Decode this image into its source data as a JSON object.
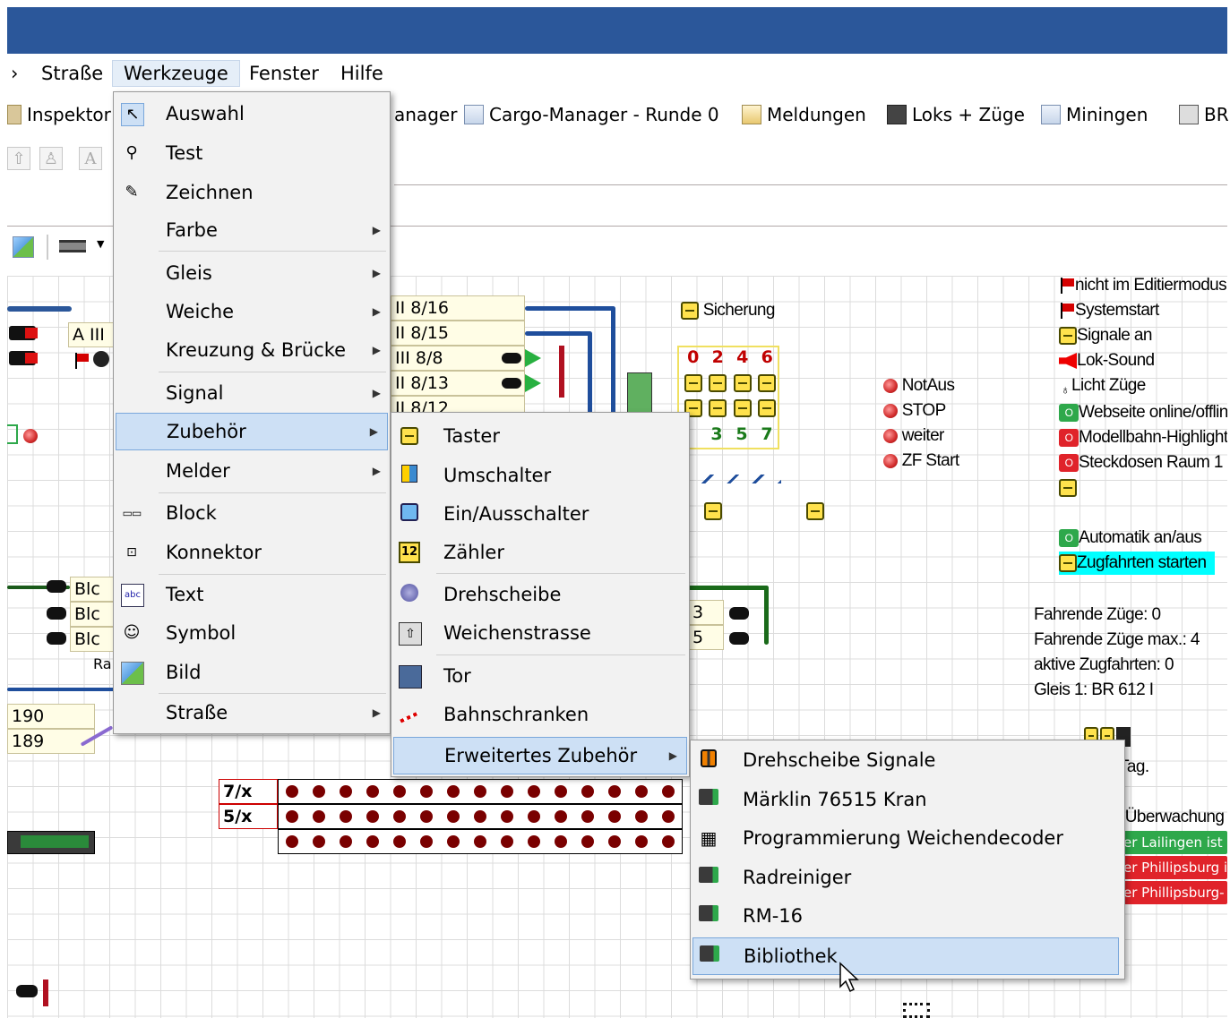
{
  "menubar": {
    "items": [
      "Straße",
      "Werkzeuge",
      "Fenster",
      "Hilfe"
    ],
    "partial_left": "›"
  },
  "toolbar": {
    "inspektor": "Inspektor",
    "manager": "anager",
    "cargo": "Cargo-Manager - Runde 0",
    "meldungen": "Meldungen",
    "loks": "Loks + Züge",
    "miningen": "Miningen",
    "br": "BR"
  },
  "werkzeuge_menu": {
    "items": [
      {
        "label": "Auswahl",
        "icon": "cursor-icon"
      },
      {
        "label": "Test",
        "icon": "test-icon"
      },
      {
        "label": "Zeichnen",
        "icon": "pencil-icon"
      },
      {
        "label": "Farbe",
        "submenu": true
      },
      {
        "label": "Gleis",
        "submenu": true
      },
      {
        "label": "Weiche",
        "submenu": true
      },
      {
        "label": "Kreuzung & Brücke",
        "submenu": true
      },
      {
        "label": "Signal",
        "submenu": true
      },
      {
        "label": "Zubehör",
        "submenu": true,
        "highlighted": true
      },
      {
        "label": "Melder",
        "submenu": true
      },
      {
        "label": "Block",
        "icon": "block-icon"
      },
      {
        "label": "Konnektor",
        "icon": "connector-icon"
      },
      {
        "label": "Text",
        "icon": "text-icon"
      },
      {
        "label": "Symbol",
        "icon": "symbol-icon"
      },
      {
        "label": "Bild",
        "icon": "image-icon"
      },
      {
        "label": "Straße",
        "submenu": true
      }
    ]
  },
  "zubehoer_menu": {
    "items": [
      {
        "label": "Taster",
        "icon": "pushbutton-icon"
      },
      {
        "label": "Umschalter",
        "icon": "switch-icon"
      },
      {
        "label": "Ein/Ausschalter",
        "icon": "onoff-icon"
      },
      {
        "label": "Zähler",
        "icon": "counter-icon",
        "icon_text": "12"
      },
      {
        "label": "Drehscheibe",
        "icon": "turntable-icon"
      },
      {
        "label": "Weichenstrasse",
        "icon": "route-icon"
      },
      {
        "label": "Tor",
        "icon": "gate-icon"
      },
      {
        "label": "Bahnschranken",
        "icon": "barrier-icon"
      },
      {
        "label": "Erweitertes Zubehör",
        "submenu": true,
        "highlighted": true
      }
    ]
  },
  "erweitert_menu": {
    "items": [
      {
        "label": "Drehscheibe Signale",
        "icon": "turntable-signal-icon"
      },
      {
        "label": "Märklin 76515 Kran",
        "icon": "loco-icon"
      },
      {
        "label": "Programmierung Weichendecoder",
        "icon": "chip-icon"
      },
      {
        "label": "Radreiniger",
        "icon": "loco-icon"
      },
      {
        "label": "RM-16",
        "icon": "loco-icon"
      },
      {
        "label": "Bibliothek",
        "icon": "loco-icon",
        "highlighted": true
      }
    ]
  },
  "canvas": {
    "tracks": [
      "II 8/16",
      "II 8/15",
      "III 8/8",
      "II 8/13",
      "II 8/12"
    ],
    "block_a": "A III",
    "sicherung": "Sicherung",
    "numbers_top": [
      "0",
      "2",
      "4",
      "6"
    ],
    "numbers_bottom": [
      "3",
      "5",
      "7"
    ],
    "notaus": [
      "NotAus",
      "STOP",
      "weiter",
      "ZF Start"
    ],
    "right_panel": [
      {
        "text": "nicht im Editiermodus",
        "icon": "flag"
      },
      {
        "text": "Systemstart",
        "icon": "flag"
      },
      {
        "text": "Signale an",
        "icon": "ybtn"
      },
      {
        "text": "Lok-Sound",
        "icon": "speaker"
      },
      {
        "text": "Licht Züge",
        "icon": "bulb"
      },
      {
        "text": "Webseite online/offline",
        "icon": "gbtn"
      },
      {
        "text": "Modellbahn-Highlight",
        "icon": "rbtn"
      },
      {
        "text": "Steckdosen Raum 1",
        "icon": "rbtn"
      }
    ],
    "automatik": "Automatik an/aus",
    "zugfahrten": "Zugfahrten starten",
    "stats": [
      "Fahrende Züge: 0",
      "Fahrende Züge max.: 4",
      "aktive Zugfahrten: 0",
      "Gleis 1: BR 612 I"
    ],
    "tag": "t Tag.",
    "ueberwachung": "-Überwachung",
    "red_rows": [
      "er Lailingen ist",
      "er Phillipsburg i",
      "er Phillipsburg-"
    ],
    "counter_labels": [
      "7/x",
      "5/x"
    ],
    "left_cells": [
      "190",
      "189"
    ],
    "blc": [
      "Blc",
      "Blc",
      "Blc"
    ],
    "ra": "Ra",
    "num_b": [
      "3",
      "5"
    ]
  },
  "colors": {
    "titlebar": "#2b579a",
    "highlight": "#cde0f5",
    "track_blue": "#1f4e9c"
  }
}
